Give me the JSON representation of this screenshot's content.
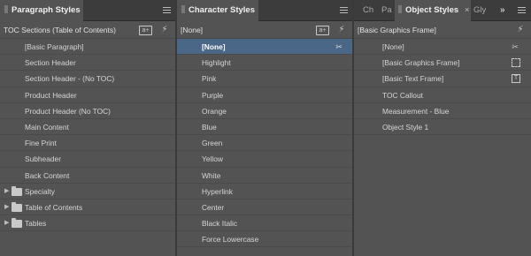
{
  "paragraph_panel": {
    "tab_label": "Paragraph Styles",
    "header": "TOC Sections (Table of Contents)",
    "items": [
      {
        "label": "[Basic Paragraph]"
      },
      {
        "label": "Section Header"
      },
      {
        "label": "Section Header - (No TOC)"
      },
      {
        "label": "Product Header"
      },
      {
        "label": "Product Header (No TOC)"
      },
      {
        "label": "Main Content"
      },
      {
        "label": "Fine Print"
      },
      {
        "label": "Subheader"
      },
      {
        "label": "Back Content"
      }
    ],
    "groups": [
      {
        "label": "Specialty"
      },
      {
        "label": "Table of Contents"
      },
      {
        "label": "Tables"
      }
    ]
  },
  "character_panel": {
    "tab_label": "Character Styles",
    "header": "[None]",
    "items": [
      {
        "label": "[None]"
      },
      {
        "label": "Highlight"
      },
      {
        "label": "Pink"
      },
      {
        "label": "Purple"
      },
      {
        "label": "Orange"
      },
      {
        "label": "Blue"
      },
      {
        "label": "Green"
      },
      {
        "label": "Yellow"
      },
      {
        "label": "White"
      },
      {
        "label": "Hyperlink"
      },
      {
        "label": "Center"
      },
      {
        "label": "Black Italic"
      },
      {
        "label": "Force Lowercase"
      }
    ],
    "selected_index": 0
  },
  "object_panel": {
    "tabs": [
      {
        "label": "Ch"
      },
      {
        "label": "Pa"
      },
      {
        "label": "Object Styles",
        "close": "×"
      },
      {
        "label": "Gly"
      }
    ],
    "overflow": "»",
    "header": "[Basic Graphics Frame]",
    "items": [
      {
        "label": "[None]"
      },
      {
        "label": "[Basic Graphics Frame]"
      },
      {
        "label": "[Basic Text Frame]"
      },
      {
        "label": "TOC Callout"
      },
      {
        "label": "Measurement - Blue"
      },
      {
        "label": "Object Style 1"
      }
    ]
  },
  "icons": {
    "new_group": "a+",
    "lightning": "⚡",
    "clear_override": "✂",
    "folder_closed": "▶"
  },
  "colors": {
    "panel_bg": "#535353",
    "selection": "#4b6787",
    "tab_bar": "#3c3c3c"
  }
}
